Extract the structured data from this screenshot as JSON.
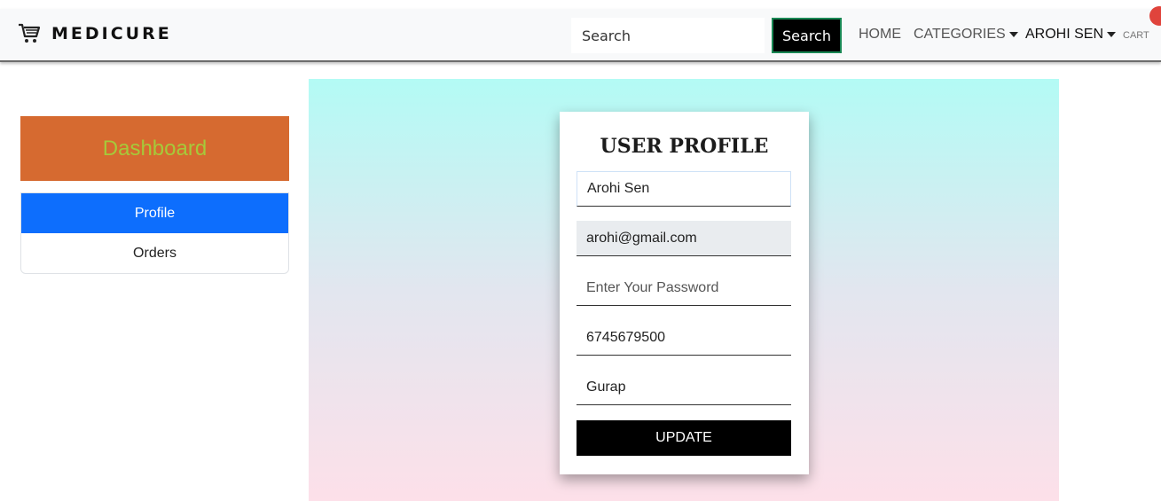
{
  "navbar": {
    "brand": "MEDICURE",
    "brand_icon": "shopping-cart-icon",
    "search_placeholder": "Search",
    "search_button": "Search",
    "links": {
      "home": "HOME",
      "categories": "CATEGORIES",
      "user": "AROHI SEN",
      "cart": "CART"
    }
  },
  "sidebar": {
    "title": "Dashboard",
    "items": [
      {
        "label": "Profile",
        "active": true
      },
      {
        "label": "Orders",
        "active": false
      }
    ]
  },
  "profile": {
    "title": "USER PROFILE",
    "name": "Arohi Sen",
    "email": "arohi@gmail.com",
    "password_placeholder": "Enter Your Password",
    "phone": "6745679500",
    "address": "Gurap",
    "update_button": "UPDATE"
  },
  "colors": {
    "sidebar_header_bg": "#d66a30",
    "sidebar_header_text": "#a6c93a",
    "active_item": "#0d6efd",
    "cart_badge": "#e0443c"
  }
}
